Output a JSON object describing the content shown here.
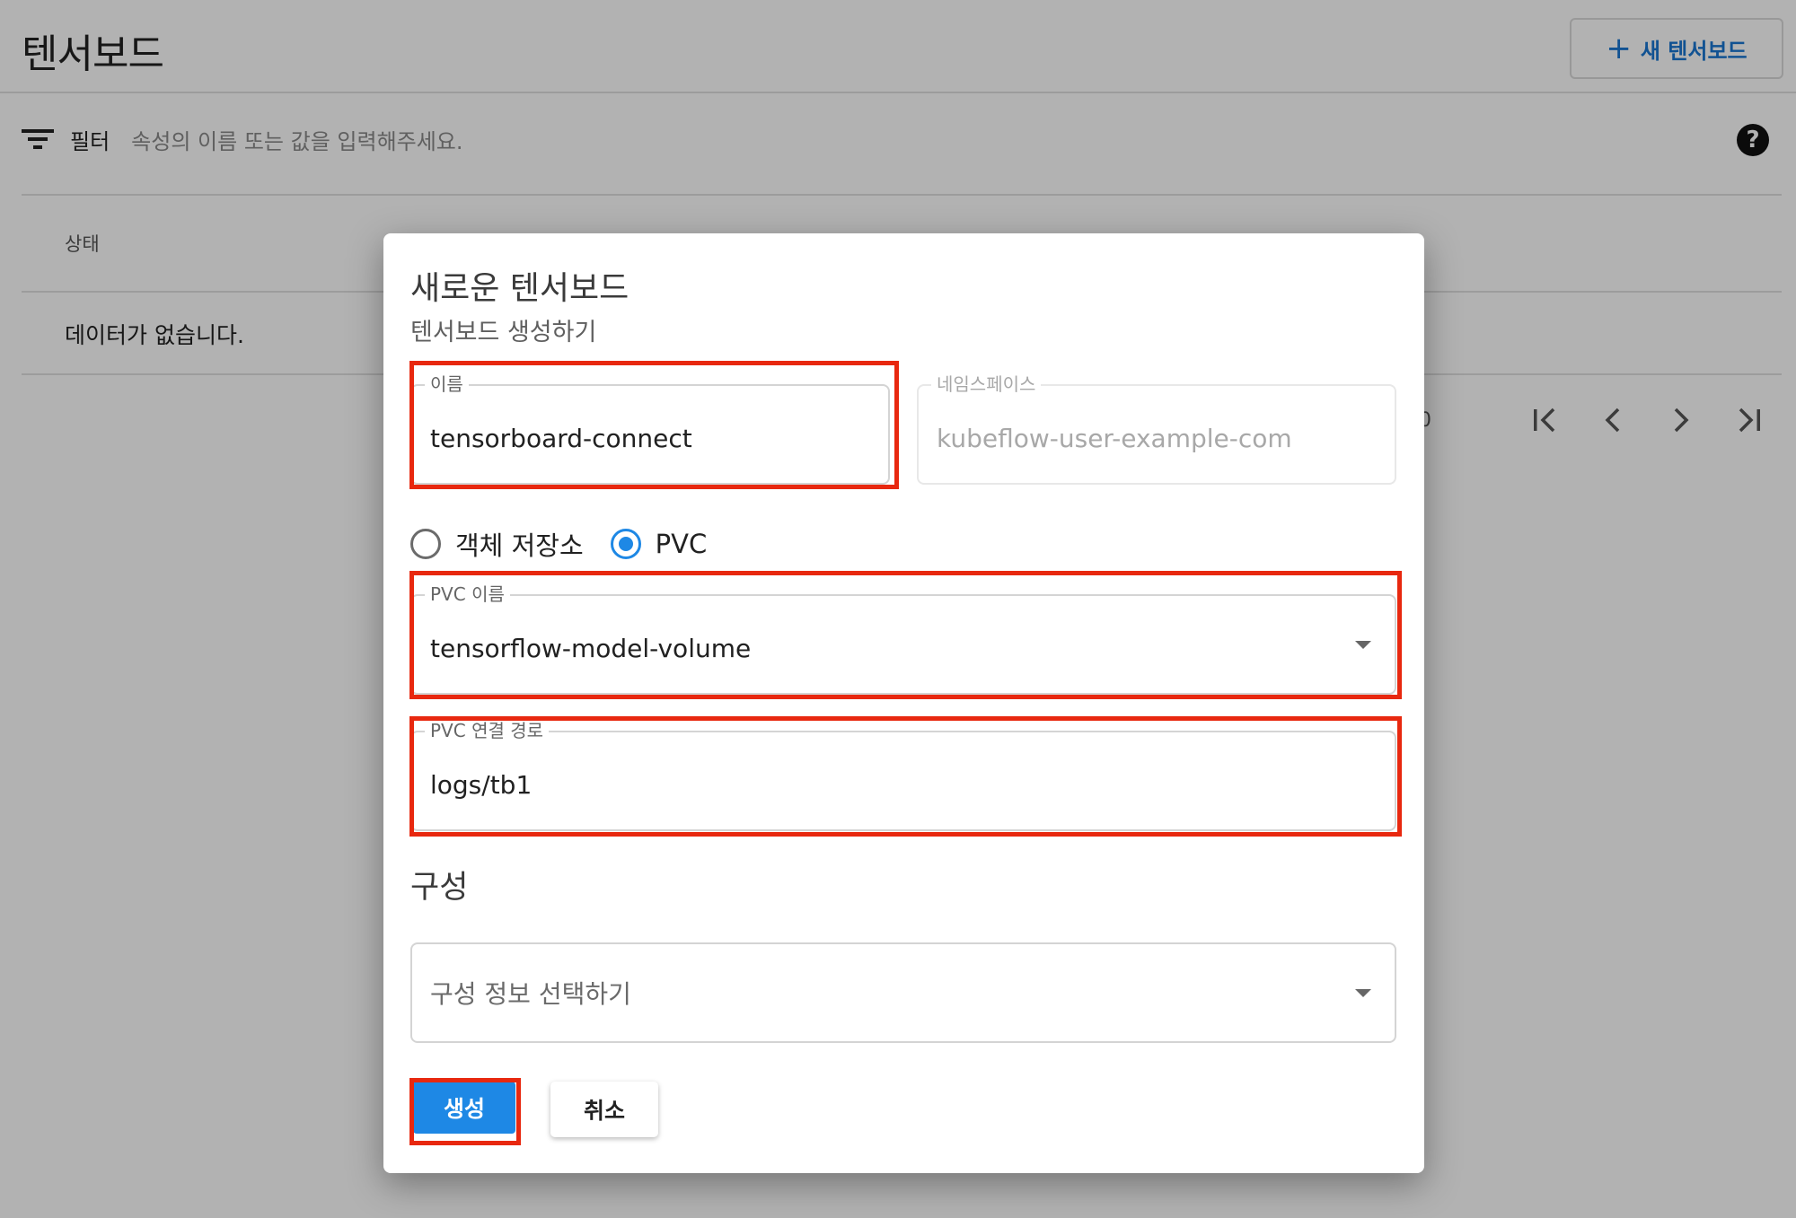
{
  "page": {
    "title": "텐서보드",
    "new_button_label": "새 텐서보드",
    "filter_label": "필터",
    "filter_placeholder": "속성의 이름 또는 값을 입력해주세요.",
    "help_symbol": "?",
    "table": {
      "column_status": "상태",
      "empty_message": "데이터가 없습니다.",
      "paginator_range_fragment": "0"
    }
  },
  "dialog": {
    "title": "새로운 텐서보드",
    "subtitle": "텐서보드 생성하기",
    "name_field": {
      "label": "이름",
      "value": "tensorboard-connect"
    },
    "namespace_field": {
      "label": "네임스페이스",
      "value": "kubeflow-user-example-com"
    },
    "storage_options": [
      {
        "label": "객체 저장소",
        "selected": false
      },
      {
        "label": "PVC",
        "selected": true
      }
    ],
    "pvc_name_field": {
      "label": "PVC 이름",
      "value": "tensorflow-model-volume"
    },
    "pvc_mount_path_field": {
      "label": "PVC 연결 경로",
      "value": "logs/tb1"
    },
    "config_section_title": "구성",
    "config_select": {
      "placeholder": "구성 정보 선택하기"
    },
    "create_button_label": "생성",
    "cancel_button_label": "취소"
  },
  "colors": {
    "accent": "#1e88e5",
    "link": "#1976d2",
    "highlight_box": "#e8280f",
    "scrim": "rgba(0,0,0,0.30)"
  },
  "icons": [
    "plus-icon",
    "filter-icon",
    "help-icon",
    "first-page-icon",
    "previous-page-icon",
    "next-page-icon",
    "last-page-icon",
    "dropdown-arrow-icon"
  ]
}
